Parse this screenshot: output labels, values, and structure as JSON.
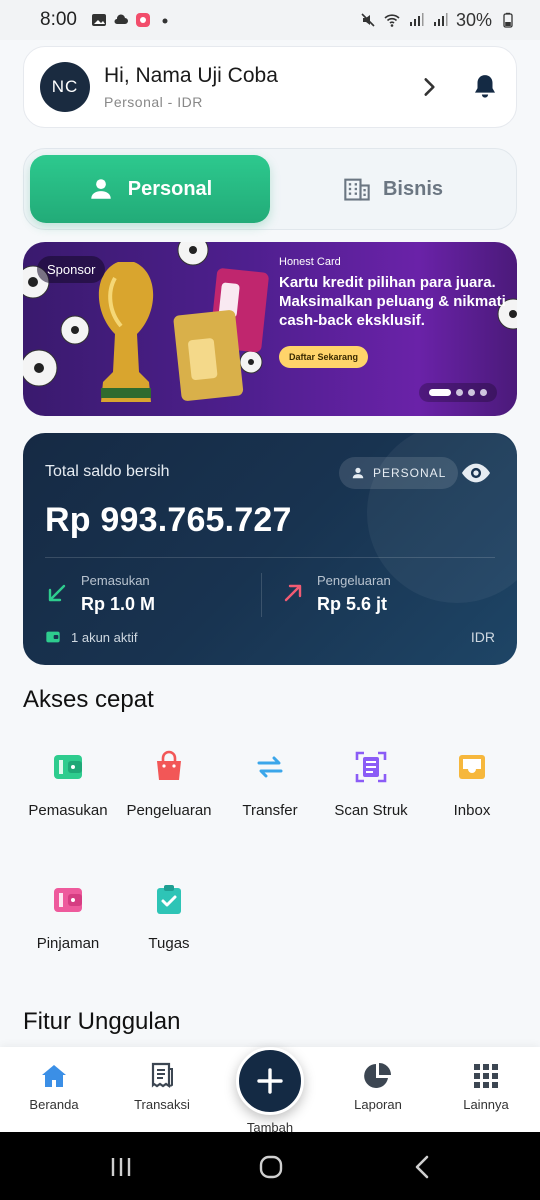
{
  "status_bar": {
    "time": "8:00",
    "battery": "30%"
  },
  "profile": {
    "initials": "NC",
    "greeting": "Hi, Nama Uji Coba",
    "subtitle": "Personal  -  IDR"
  },
  "segment": {
    "personal": "Personal",
    "bisnis": "Bisnis"
  },
  "banner": {
    "sponsor": "Sponsor",
    "label": "Honest Card",
    "text": "Kartu kredit pilihan para juara. Maksimalkan peluang & nikmati cash-back eksklusif.",
    "button": "Daftar Sekarang",
    "slides": 4,
    "active_slide": 1
  },
  "balance": {
    "label": "Total saldo bersih",
    "chip": "PERSONAL",
    "amount": "Rp 993.765.727",
    "income_label": "Pemasukan",
    "income_value": "Rp 1.0 M",
    "expense_label": "Pengeluaran",
    "expense_value": "Rp 5.6 jt",
    "accounts": "1 akun aktif",
    "currency": "IDR"
  },
  "quick_access": {
    "title": "Akses cepat",
    "items": [
      {
        "label": "Pemasukan",
        "icon": "wallet-icon",
        "color": "#2ecc8e"
      },
      {
        "label": "Pengeluaran",
        "icon": "shopping-bag-icon",
        "color": "#f25757"
      },
      {
        "label": "Transfer",
        "icon": "transfer-icon",
        "color": "#3ba6ea"
      },
      {
        "label": "Scan Struk",
        "icon": "scan-receipt-icon",
        "color": "#8b5cf6"
      },
      {
        "label": "Inbox",
        "icon": "inbox-icon",
        "color": "#f6b73c"
      },
      {
        "label": "Pinjaman",
        "icon": "loan-wallet-icon",
        "color": "#ee5a9c"
      },
      {
        "label": "Tugas",
        "icon": "clipboard-check-icon",
        "color": "#2ec4b6"
      }
    ]
  },
  "features_title": "Fitur Unggulan",
  "bottom_nav": {
    "items": [
      "Beranda",
      "Transaksi",
      "Tambah",
      "Laporan",
      "Lainnya"
    ],
    "active": "Beranda",
    "accent": "#3b8fe6"
  }
}
